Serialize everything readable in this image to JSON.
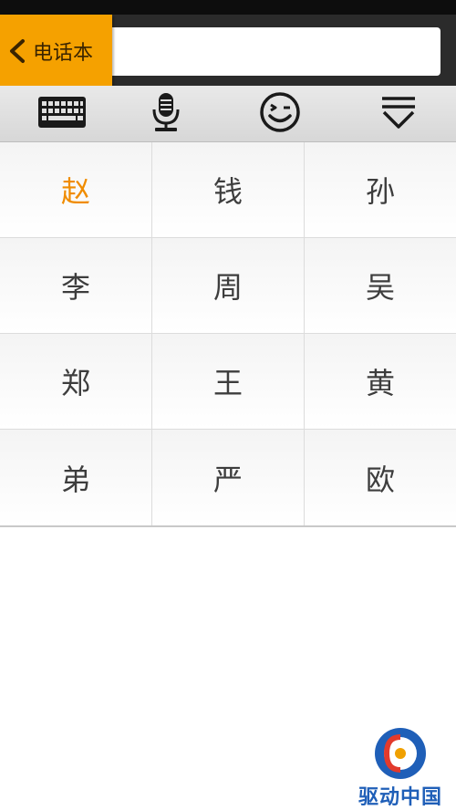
{
  "header": {
    "back_label": "电话本",
    "search_value": "",
    "search_placeholder": ""
  },
  "toolbar": {
    "items": [
      {
        "icon": "keyboard-icon"
      },
      {
        "icon": "microphone-icon"
      },
      {
        "icon": "emoji-icon"
      },
      {
        "icon": "collapse-keyboard-icon"
      }
    ]
  },
  "grid": {
    "rows": [
      [
        "赵",
        "钱",
        "孙"
      ],
      [
        "李",
        "周",
        "吴"
      ],
      [
        "郑",
        "王",
        "黄"
      ],
      [
        "弟",
        "严",
        "欧"
      ]
    ],
    "active": "赵"
  },
  "watermark": {
    "text": "驱动中国"
  },
  "colors": {
    "accent": "#f5a100",
    "active_text": "#f08c00",
    "header_bg": "#2b2b2b",
    "brand_blue": "#1f5fb8"
  }
}
